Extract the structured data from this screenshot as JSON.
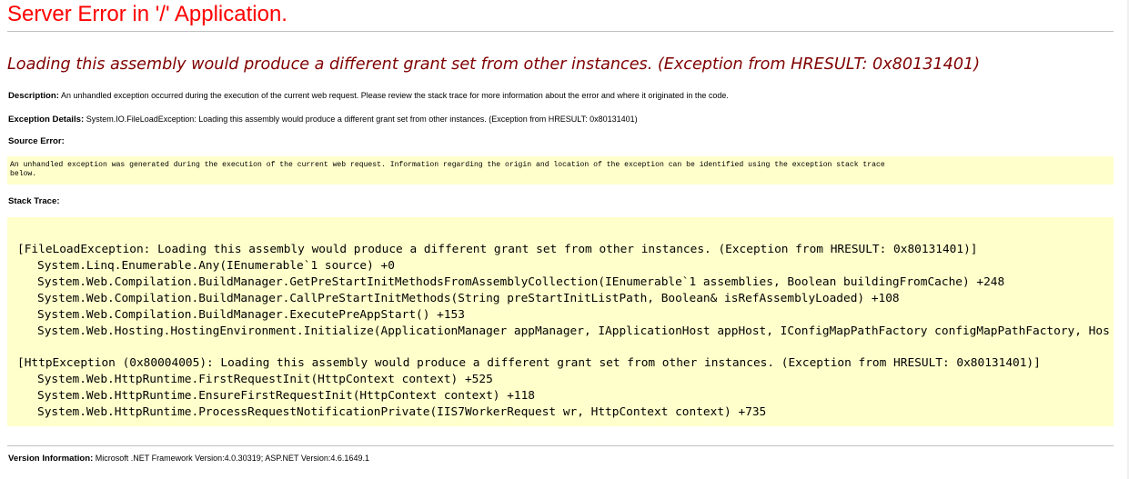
{
  "page": {
    "title": "Server Error in '/' Application.",
    "subtitle": "Loading this assembly would produce a different grant set from other instances. (Exception from HRESULT: 0x80131401)"
  },
  "description": {
    "label": "Description:",
    "text": "An unhandled exception occurred during the execution of the current web request. Please review the stack trace for more information about the error and where it originated in the code."
  },
  "exception_details": {
    "label": "Exception Details:",
    "text": "System.IO.FileLoadException: Loading this assembly would produce a different grant set from other instances. (Exception from HRESULT: 0x80131401)"
  },
  "source_error": {
    "label": "Source Error:",
    "lines": [
      "An unhandled exception was generated during the execution of the current web request. Information regarding the origin and location of the exception can be identified using the exception stack trace",
      "below."
    ]
  },
  "stack_trace": {
    "label": "Stack Trace:",
    "blocks": [
      {
        "header": "[FileLoadException: Loading this assembly would produce a different grant set from other instances. (Exception from HRESULT: 0x80131401)]",
        "frames": [
          "System.Linq.Enumerable.Any(IEnumerable`1 source) +0",
          "System.Web.Compilation.BuildManager.GetPreStartInitMethodsFromAssemblyCollection(IEnumerable`1 assemblies, Boolean buildingFromCache) +248",
          "System.Web.Compilation.BuildManager.CallPreStartInitMethods(String preStartInitListPath, Boolean& isRefAssemblyLoaded) +108",
          "System.Web.Compilation.BuildManager.ExecutePreAppStart() +153",
          "System.Web.Hosting.HostingEnvironment.Initialize(ApplicationManager appManager, IApplicationHost appHost, IConfigMapPathFactory configMapPathFactory, Hos"
        ]
      },
      {
        "header": "[HttpException (0x80004005): Loading this assembly would produce a different grant set from other instances. (Exception from HRESULT: 0x80131401)]",
        "frames": [
          "System.Web.HttpRuntime.FirstRequestInit(HttpContext context) +525",
          "System.Web.HttpRuntime.EnsureFirstRequestInit(HttpContext context) +118",
          "System.Web.HttpRuntime.ProcessRequestNotificationPrivate(IIS7WorkerRequest wr, HttpContext context) +735"
        ]
      }
    ]
  },
  "version_information": {
    "label": "Version Information:",
    "text": "Microsoft .NET Framework Version:4.0.30319; ASP.NET Version:4.6.1649.1"
  },
  "colors": {
    "title": "#ff0000",
    "subtitle": "#800000",
    "code_background": "#ffffcc",
    "rule": "#c0c0c0"
  }
}
